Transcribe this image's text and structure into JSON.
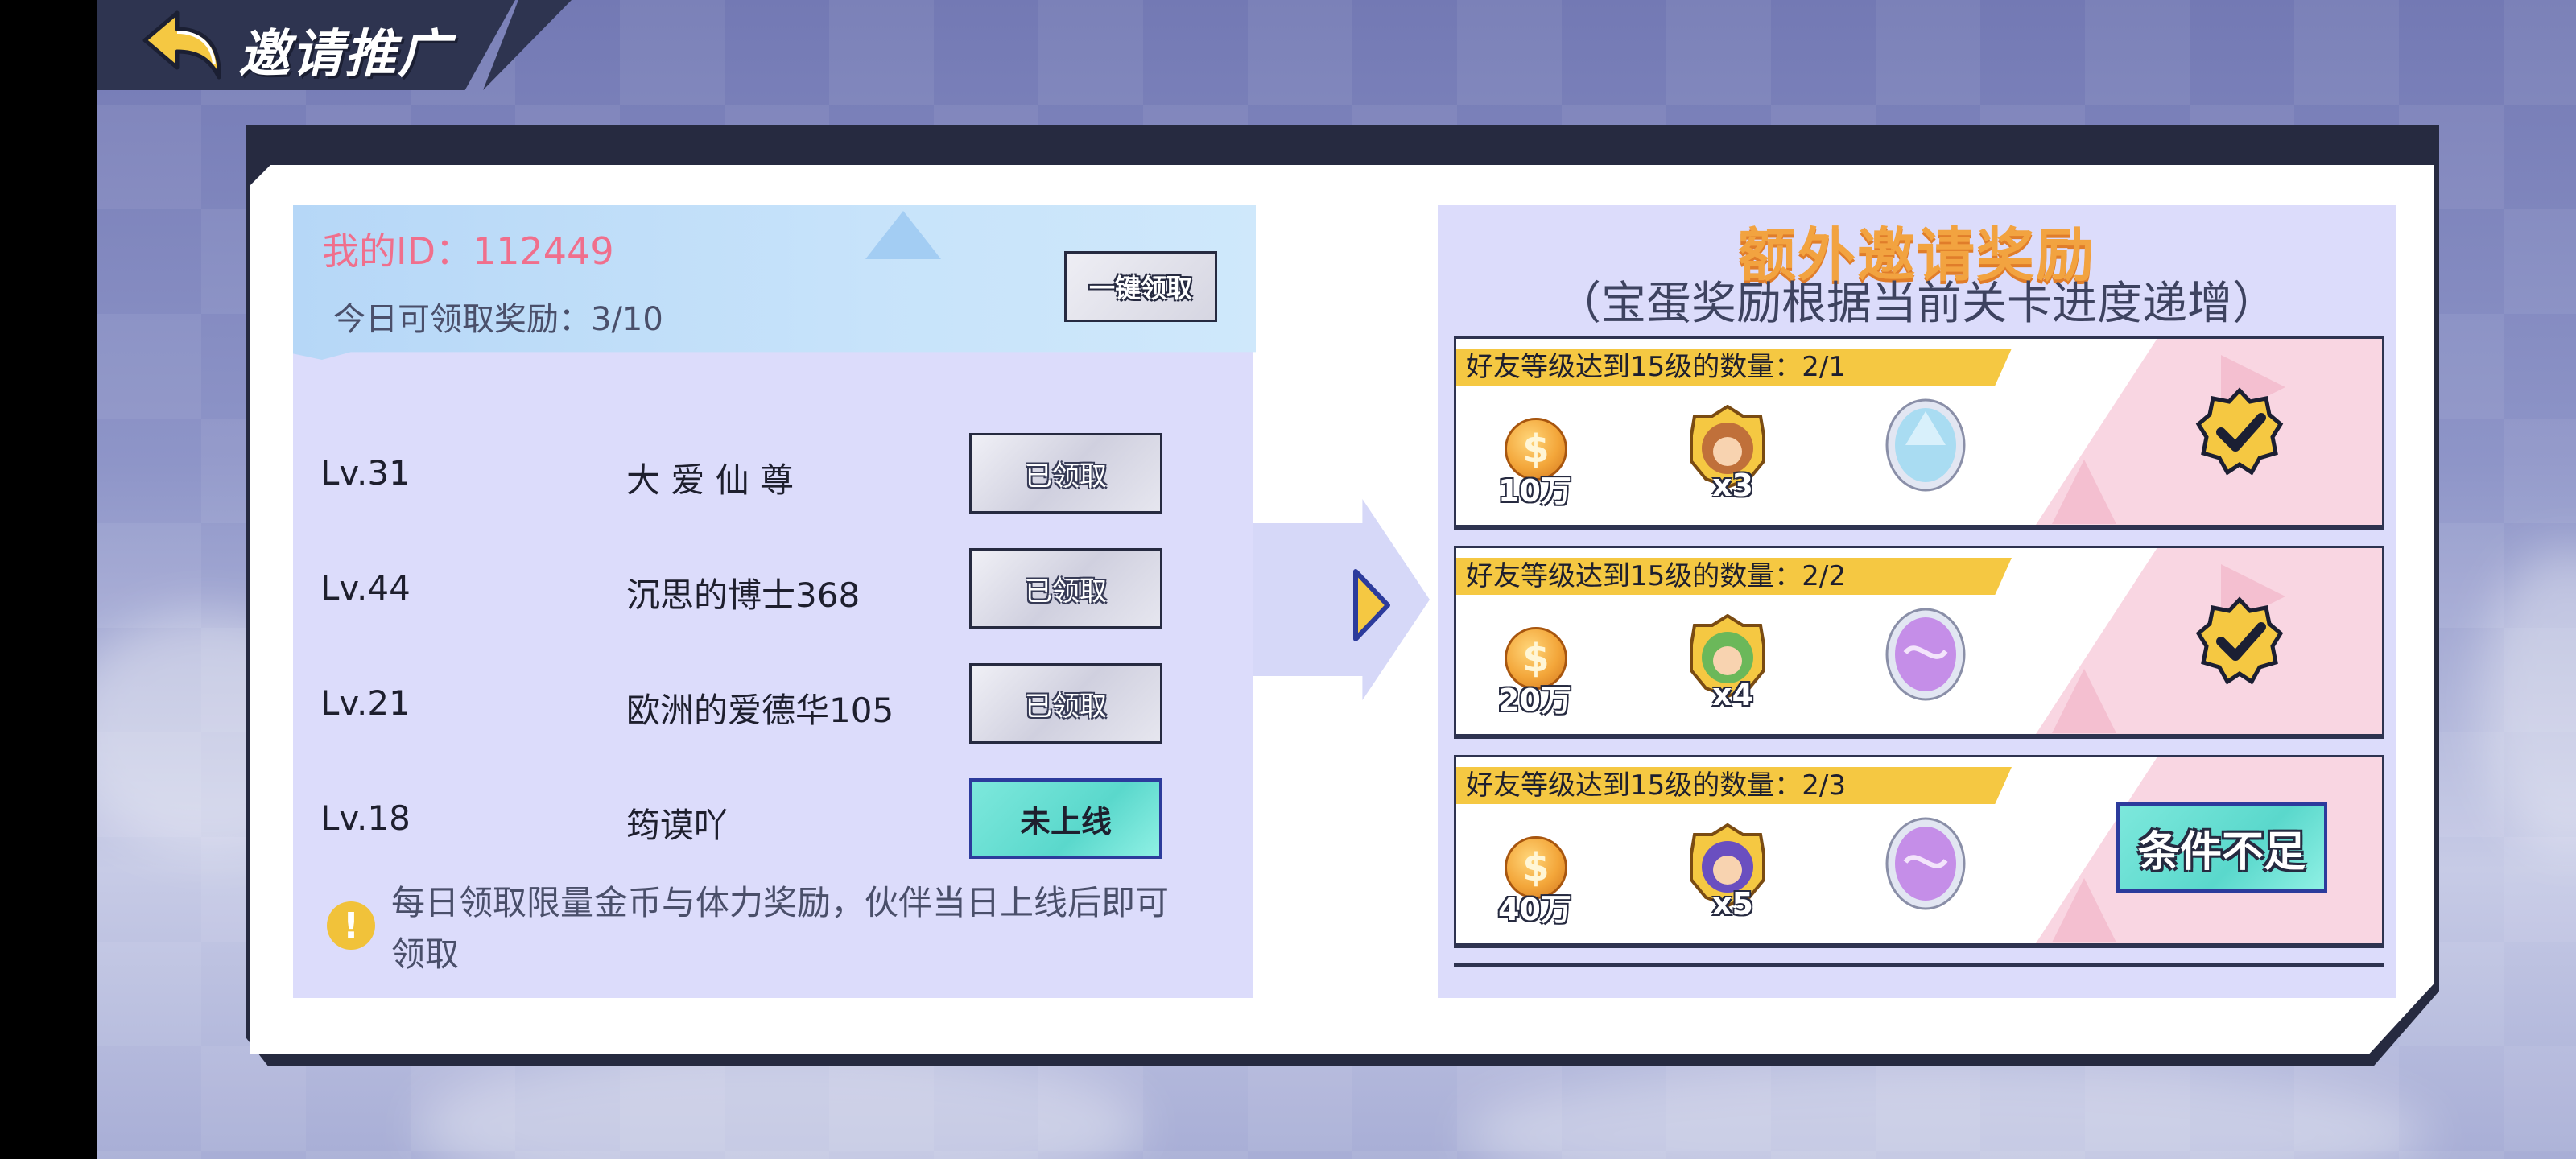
{
  "header": {
    "title": "邀请推广",
    "back_icon": "back-arrow-icon"
  },
  "invite": {
    "my_id": "我的ID：112449",
    "today_reward": "今日可领取奖励：3/10",
    "claim_all_label": "一键领取"
  },
  "friends": [
    {
      "level": "Lv.31",
      "name": "大 爱 仙 尊",
      "status": "已领取",
      "state": "claimed"
    },
    {
      "level": "Lv.44",
      "name": "沉思的博士368",
      "status": "已领取",
      "state": "claimed"
    },
    {
      "level": "Lv.21",
      "name": "欧洲的爱德华105",
      "status": "已领取",
      "state": "claimed"
    },
    {
      "level": "Lv.18",
      "name": "筠谟吖",
      "status": "未上线",
      "state": "offline"
    }
  ],
  "notice": {
    "icon": "exclamation-icon",
    "text": "每日领取限量金币与体力奖励，伙伴当日上线后即可领取"
  },
  "extra": {
    "title": "额外邀请奖励",
    "subtitle": "（宝蛋奖励根据当前关卡进度递增）",
    "tiers": [
      {
        "condition": "好友等级达到15级的数量：2/1",
        "coins": "10万",
        "hero_qty": "x3",
        "status": "completed",
        "hero_color": "#c0703a",
        "egg_color": "#a9dcf2"
      },
      {
        "condition": "好友等级达到15级的数量：2/2",
        "coins": "20万",
        "hero_qty": "x4",
        "status": "completed",
        "hero_color": "#6bb85a",
        "egg_color": "#c58ee8"
      },
      {
        "condition": "好友等级达到15级的数量：2/3",
        "coins": "40万",
        "hero_qty": "x5",
        "status": "条件不足",
        "hero_color": "#6a4fc0",
        "egg_color": "#c58ee8"
      }
    ]
  },
  "colors": {
    "accent_pink": "#f06f8c",
    "accent_gold": "#f2a340",
    "teal_button": "#5ad8cc",
    "panel_dark": "#262a40"
  }
}
